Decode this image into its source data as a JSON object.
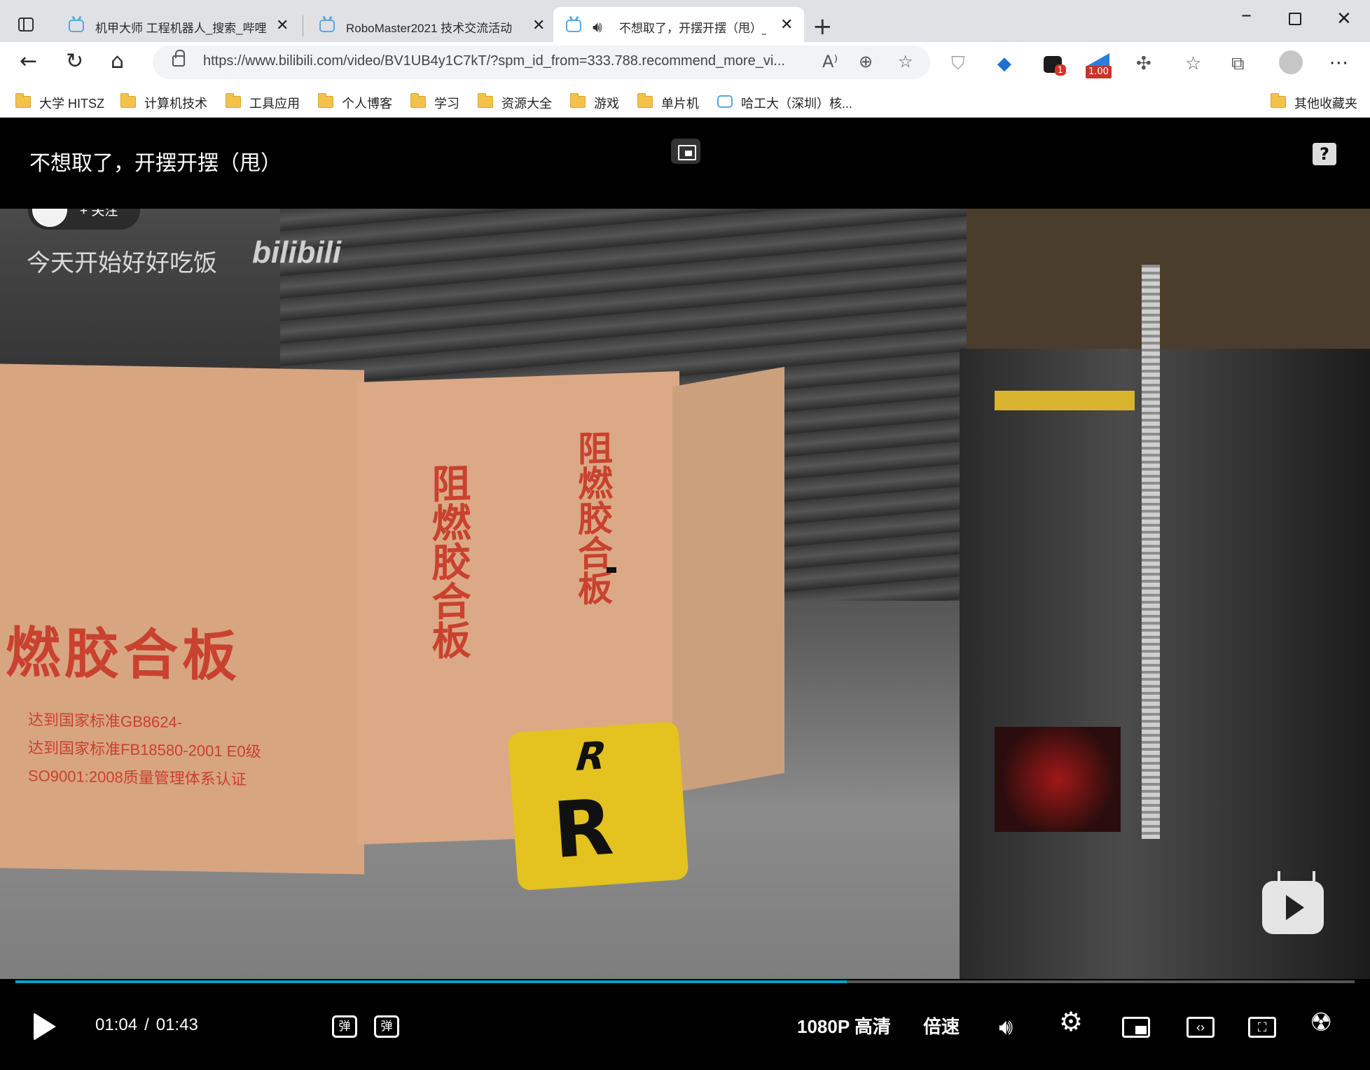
{
  "tabs": [
    {
      "title": "机甲大师 工程机器人_搜索_哔哩哔哩"
    },
    {
      "title": "RoboMaster2021 技术交流活动"
    },
    {
      "title": "不想取了，开摆开摆（甩）_哔哩哔哩"
    }
  ],
  "address_bar": {
    "url": "https://www.bilibili.com/video/BV1UB4y1C7kT/?spm_id_from=333.788.recommend_more_vi..."
  },
  "extensions": {
    "badge_count": "1",
    "speed_value": "1.00"
  },
  "bookmarks": [
    {
      "label": "大学 HITSZ",
      "type": "folder"
    },
    {
      "label": "计算机技术",
      "type": "folder"
    },
    {
      "label": "工具应用",
      "type": "folder"
    },
    {
      "label": "个人博客",
      "type": "folder"
    },
    {
      "label": "学习",
      "type": "folder"
    },
    {
      "label": "资源大全",
      "type": "folder"
    },
    {
      "label": "游戏",
      "type": "folder"
    },
    {
      "label": "单片机",
      "type": "folder"
    },
    {
      "label": "哈工大（深圳）核...",
      "type": "site"
    },
    {
      "label": "其他收藏夹",
      "type": "folder"
    }
  ],
  "player": {
    "title": "不想取了，开摆开摆（甩）",
    "help": "?",
    "follow_label": "+ 关注",
    "watermark_text": "今天开始好好吃饭",
    "watermark_logo": "bilibili",
    "progress": 0.621,
    "current_time": "01:04",
    "time_separator": "/",
    "total_time": "01:43",
    "danmaku_toggle": "弹",
    "danmaku_settings": "弹",
    "quality": "1080P 高清",
    "speed": "倍速"
  },
  "video_scene": {
    "box_left_text": "燃胶合板",
    "box_left_small": [
      "达到国家标准GB8624-",
      "达到国家标准FB18580-2001 E0级",
      "SO9001:2008质量管理体系认证"
    ],
    "box_mid_text": "阻燃胶合板",
    "cube_letter": "R"
  },
  "colors": {
    "accent": "#00a1d6",
    "tab_bg": "#dfe1e4",
    "folder": "#f2c24b"
  }
}
